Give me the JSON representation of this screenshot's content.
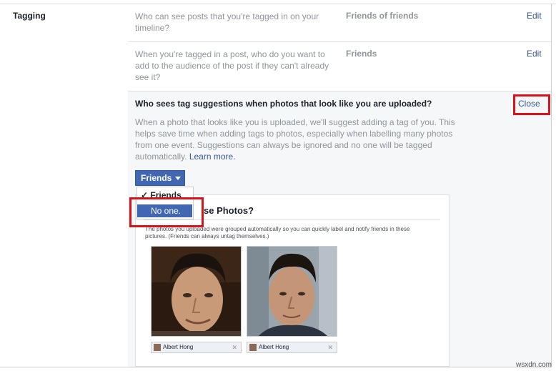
{
  "section": {
    "label": "Tagging"
  },
  "rows": [
    {
      "question": "Who can see posts that you're tagged in on your timeline?",
      "value": "Friends of friends",
      "action": "Edit"
    },
    {
      "question": "When you're tagged in a post, who do you want to add to the audience of the post if they can't already see it?",
      "value": "Friends",
      "action": "Edit"
    }
  ],
  "expanded": {
    "title": "Who sees tag suggestions when photos that look like you are uploaded?",
    "description": "When a photo that looks like you is uploaded, we'll suggest adding a tag of you. This helps save time when adding tags to photos, especially when labelling many photos from one event. Suggestions can always be ignored and no one will be tagged automatically.",
    "learn_more": "Learn more.",
    "close": "Close",
    "dropdown": {
      "selected": "Friends",
      "options": [
        {
          "label": "Friends",
          "checked": true
        },
        {
          "label": "No one.",
          "highlighted": true
        }
      ]
    }
  },
  "preview": {
    "title_fragment": "se Photos?",
    "description": "The photos you uploaded were grouped automatically so you can quickly label and notify friends in these pictures. (Friends can always untag themselves.)",
    "tags": [
      {
        "name": "Albert Hong"
      },
      {
        "name": "Albert Hong"
      }
    ]
  },
  "colors": {
    "highlight_box": "#d9121c",
    "accent": "#4267b2",
    "link": "#365899"
  },
  "watermark": "wsxdn.com"
}
